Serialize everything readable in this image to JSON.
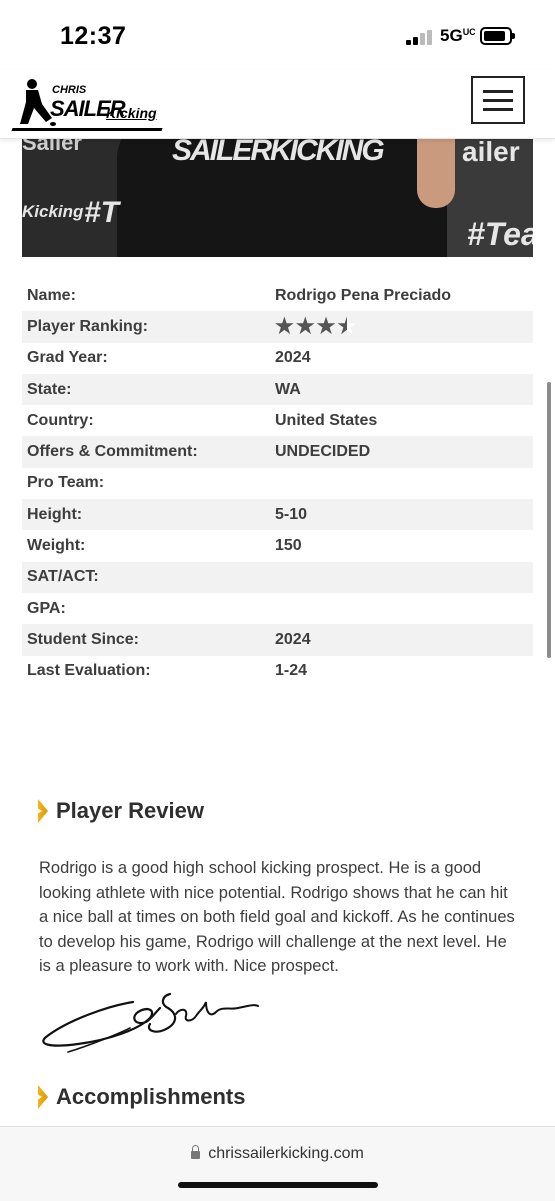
{
  "status_bar": {
    "time": "12:37",
    "network": "5G",
    "network_suffix": "UC"
  },
  "site": {
    "logo": {
      "chris": "CHRIS",
      "sailer": "SAILER",
      "kicking": "Kicking"
    }
  },
  "hero": {
    "shirt_print": "SAILERKICKING",
    "tag_left": "Kicking",
    "hash_left": "#T",
    "hash_right": "#Tea",
    "sailer_right": "ailer"
  },
  "profile": {
    "rows": [
      {
        "label": "Name:",
        "value": "Rodrigo Pena Preciado"
      },
      {
        "label": "Player Ranking:",
        "value": ""
      },
      {
        "label": "Grad Year:",
        "value": "2024"
      },
      {
        "label": "State:",
        "value": "WA"
      },
      {
        "label": "Country:",
        "value": "United States"
      },
      {
        "label": "Offers & Commitment:",
        "value": "UNDECIDED"
      },
      {
        "label": "Pro Team:",
        "value": ""
      },
      {
        "label": "Height:",
        "value": "5-10"
      },
      {
        "label": "Weight:",
        "value": "150"
      },
      {
        "label": "SAT/ACT:",
        "value": ""
      },
      {
        "label": "GPA:",
        "value": ""
      },
      {
        "label": "Student Since:",
        "value": "2024"
      },
      {
        "label": "Last Evaluation:",
        "value": "1-24"
      }
    ],
    "ranking_stars": 3.5
  },
  "review": {
    "title": "Player Review",
    "text": "Rodrigo is a good high school kicking prospect. He is a good looking athlete with nice potential. Rodrigo shows that he can hit a nice ball at times on both field goal and kickoff. As he continues to develop his game, Rodrigo will challenge at the next level. He is a pleasure to work with. Nice prospect."
  },
  "accomplishments": {
    "title": "Accomplishments"
  },
  "browser": {
    "url": "chrissailerkicking.com"
  },
  "colors": {
    "accent_chevron": "#f1b51c",
    "row_stripe": "#f2f2f2"
  }
}
